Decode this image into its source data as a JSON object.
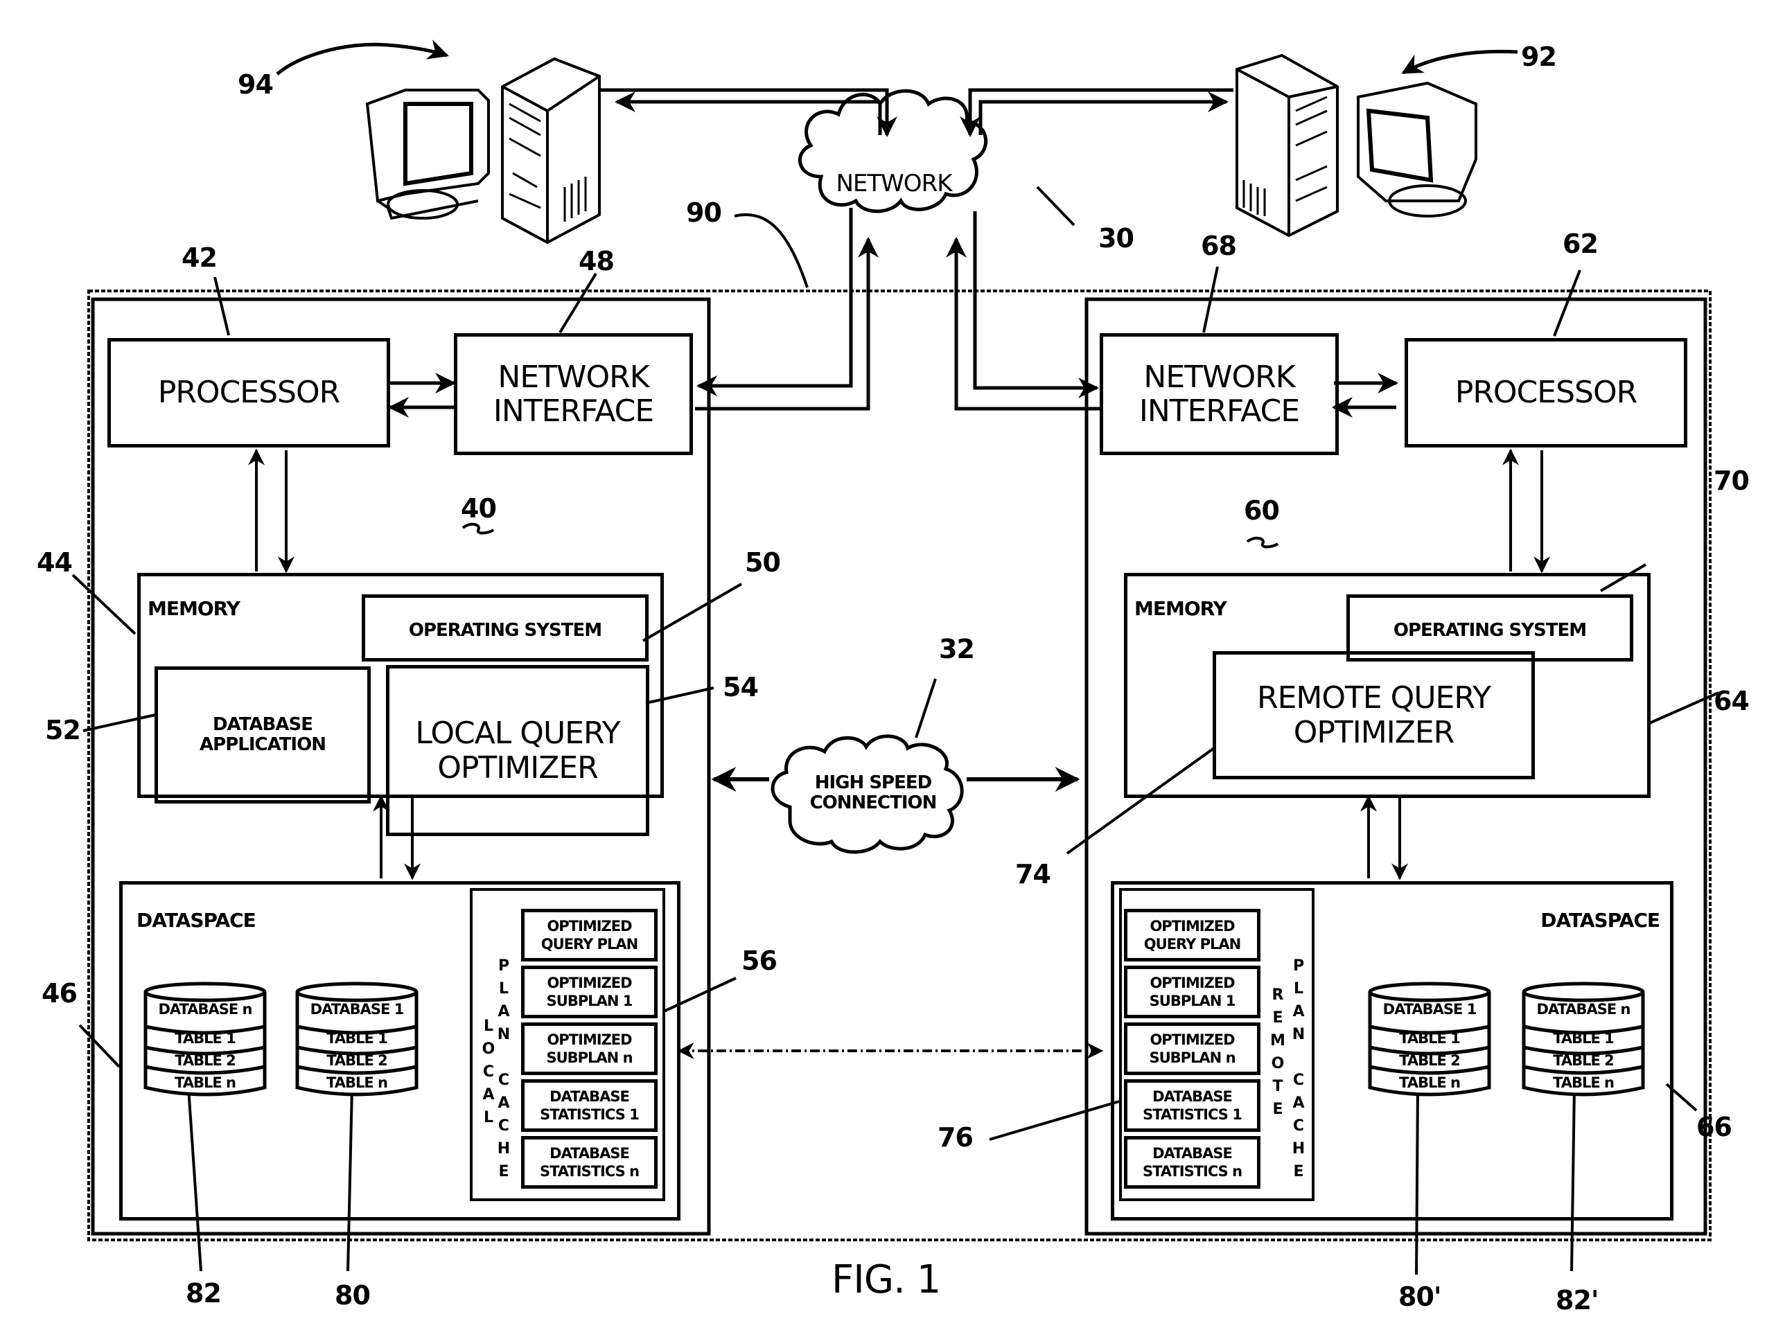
{
  "figure": {
    "caption": "FIG. 1",
    "network_cloud": {
      "label": "NETWORK",
      "ref": "30"
    },
    "high_speed_cloud": {
      "label_line1": "HIGH SPEED",
      "label_line2": "CONNECTION",
      "ref": "32"
    },
    "system_boundary_ref": "90",
    "left_client_ref": "94",
    "right_client_ref": "92"
  },
  "local": {
    "system_ref": "40",
    "processor": {
      "label": "PROCESSOR",
      "ref": "42"
    },
    "network_interface": {
      "label_line1": "NETWORK",
      "label_line2": "INTERFACE",
      "ref": "48"
    },
    "memory": {
      "label": "MEMORY",
      "ref": "44"
    },
    "operating_system": {
      "label": "OPERATING SYSTEM",
      "ref": "50"
    },
    "database_application": {
      "label_line1": "DATABASE",
      "label_line2": "APPLICATION",
      "ref": "52"
    },
    "query_optimizer": {
      "label_line1": "LOCAL QUERY",
      "label_line2": "OPTIMIZER",
      "ref": "54"
    },
    "dataspace": {
      "label": "DATASPACE",
      "ref": "46"
    },
    "plan_cache": {
      "ref": "56",
      "title_col1": [
        "L",
        "O",
        "C",
        "A",
        "L"
      ],
      "title_col2": [
        "P",
        "L",
        "A",
        "N",
        "",
        "C",
        "A",
        "C",
        "H",
        "E"
      ],
      "entries": [
        {
          "line1": "OPTIMIZED",
          "line2": "QUERY PLAN"
        },
        {
          "line1": "OPTIMIZED",
          "line2": "SUBPLAN 1"
        },
        {
          "line1": "OPTIMIZED",
          "line2": "SUBPLAN n"
        },
        {
          "line1": "DATABASE",
          "line2": "STATISTICS 1"
        },
        {
          "line1": "DATABASE",
          "line2": "STATISTICS n"
        }
      ]
    },
    "databases": [
      {
        "name": "DATABASE n",
        "tables": [
          "TABLE 1",
          "TABLE 2",
          "TABLE n"
        ],
        "ref": "82"
      },
      {
        "name": "DATABASE 1",
        "tables": [
          "TABLE 1",
          "TABLE 2",
          "TABLE n"
        ],
        "ref": "80"
      }
    ]
  },
  "remote": {
    "system_ref": "60",
    "processor": {
      "label": "PROCESSOR",
      "ref": "62"
    },
    "network_interface": {
      "label_line1": "NETWORK",
      "label_line2": "INTERFACE",
      "ref": "68"
    },
    "memory": {
      "label": "MEMORY",
      "ref": "64"
    },
    "operating_system": {
      "label": "OPERATING SYSTEM",
      "ref": "70"
    },
    "query_optimizer": {
      "label_line1": "REMOTE QUERY",
      "label_line2": "OPTIMIZER",
      "ref": "74"
    },
    "dataspace": {
      "label": "DATASPACE",
      "ref": "66"
    },
    "plan_cache": {
      "ref": "76",
      "title_col1": [
        "R",
        "E",
        "M",
        "O",
        "T",
        "E"
      ],
      "title_col2": [
        "P",
        "L",
        "A",
        "N",
        "",
        "C",
        "A",
        "C",
        "H",
        "E"
      ],
      "entries": [
        {
          "line1": "OPTIMIZED",
          "line2": "QUERY PLAN"
        },
        {
          "line1": "OPTIMIZED",
          "line2": "SUBPLAN 1"
        },
        {
          "line1": "OPTIMIZED",
          "line2": "SUBPLAN n"
        },
        {
          "line1": "DATABASE",
          "line2": "STATISTICS 1"
        },
        {
          "line1": "DATABASE",
          "line2": "STATISTICS n"
        }
      ]
    },
    "databases": [
      {
        "name": "DATABASE 1",
        "tables": [
          "TABLE 1",
          "TABLE 2",
          "TABLE n"
        ],
        "ref": "80'"
      },
      {
        "name": "DATABASE n",
        "tables": [
          "TABLE 1",
          "TABLE 2",
          "TABLE n"
        ],
        "ref": "82'"
      }
    ]
  }
}
